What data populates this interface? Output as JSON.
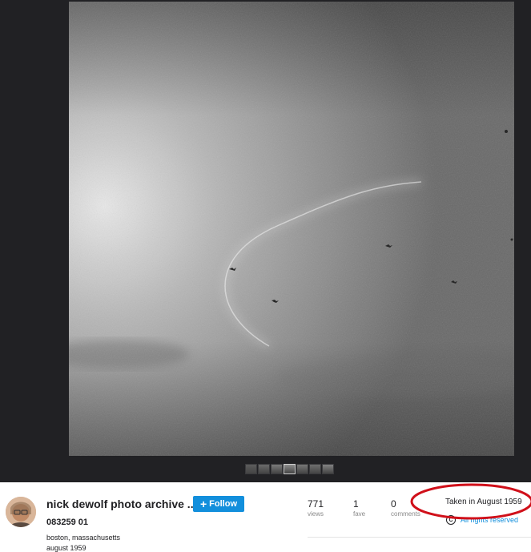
{
  "photo": {
    "alt": "Black and white photograph of a grey sky with a faint contrail and a few birds",
    "thumbnail_count": 7,
    "active_thumbnail_index": 3
  },
  "owner": {
    "name": "nick dewolf photo archive ...",
    "follow_label": "Follow"
  },
  "title": "083259 01",
  "description": {
    "line1": "boston, massachusetts",
    "line2": "august 1959"
  },
  "stats": [
    {
      "value": "771",
      "label": "views"
    },
    {
      "value": "1",
      "label": "fave"
    },
    {
      "value": "0",
      "label": "comments"
    }
  ],
  "taken": "Taken in August 1959",
  "rights": {
    "label": "All rights reserved",
    "icon_glyph": "C"
  },
  "colors": {
    "viewer_bg": "#212124",
    "accent": "#128fdc",
    "annotation": "#d0101a"
  }
}
